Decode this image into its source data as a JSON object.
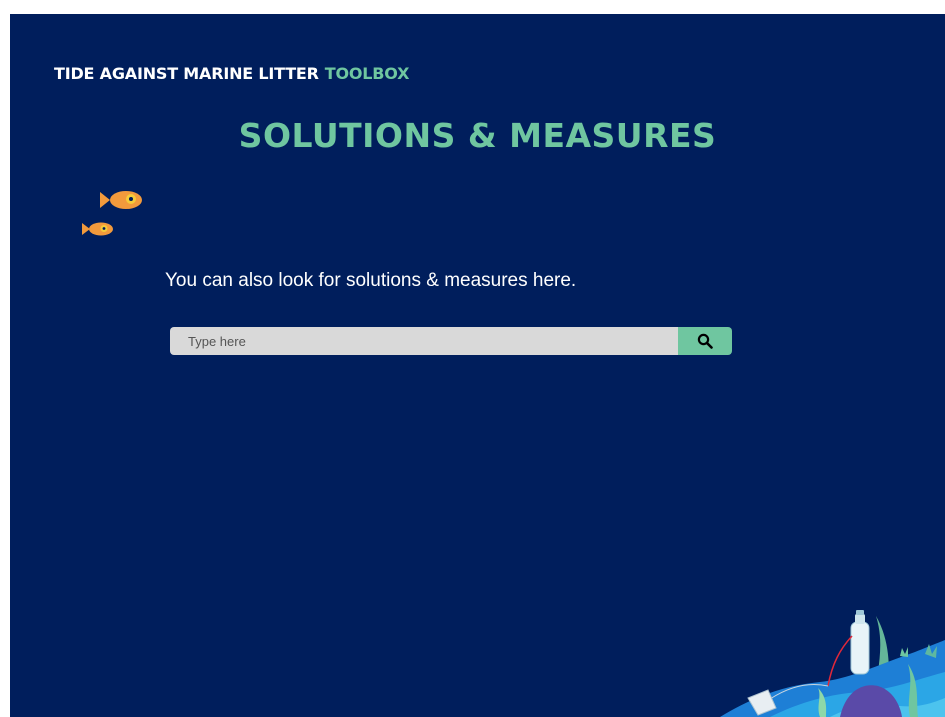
{
  "header": {
    "brand_main": "TIDE AGAINST MARINE LITTER",
    "brand_accent": "TOOLBOX"
  },
  "page": {
    "title": "SOLUTIONS & MEASURES",
    "lead_text": "You can also look for solutions & measures here."
  },
  "search": {
    "placeholder": "Type here",
    "value": "",
    "button_icon": "search-icon"
  },
  "colors": {
    "background": "#001e5c",
    "accent": "#6fc6a0",
    "fish": "#f29a3c",
    "input_bg": "#d9d9d9"
  }
}
